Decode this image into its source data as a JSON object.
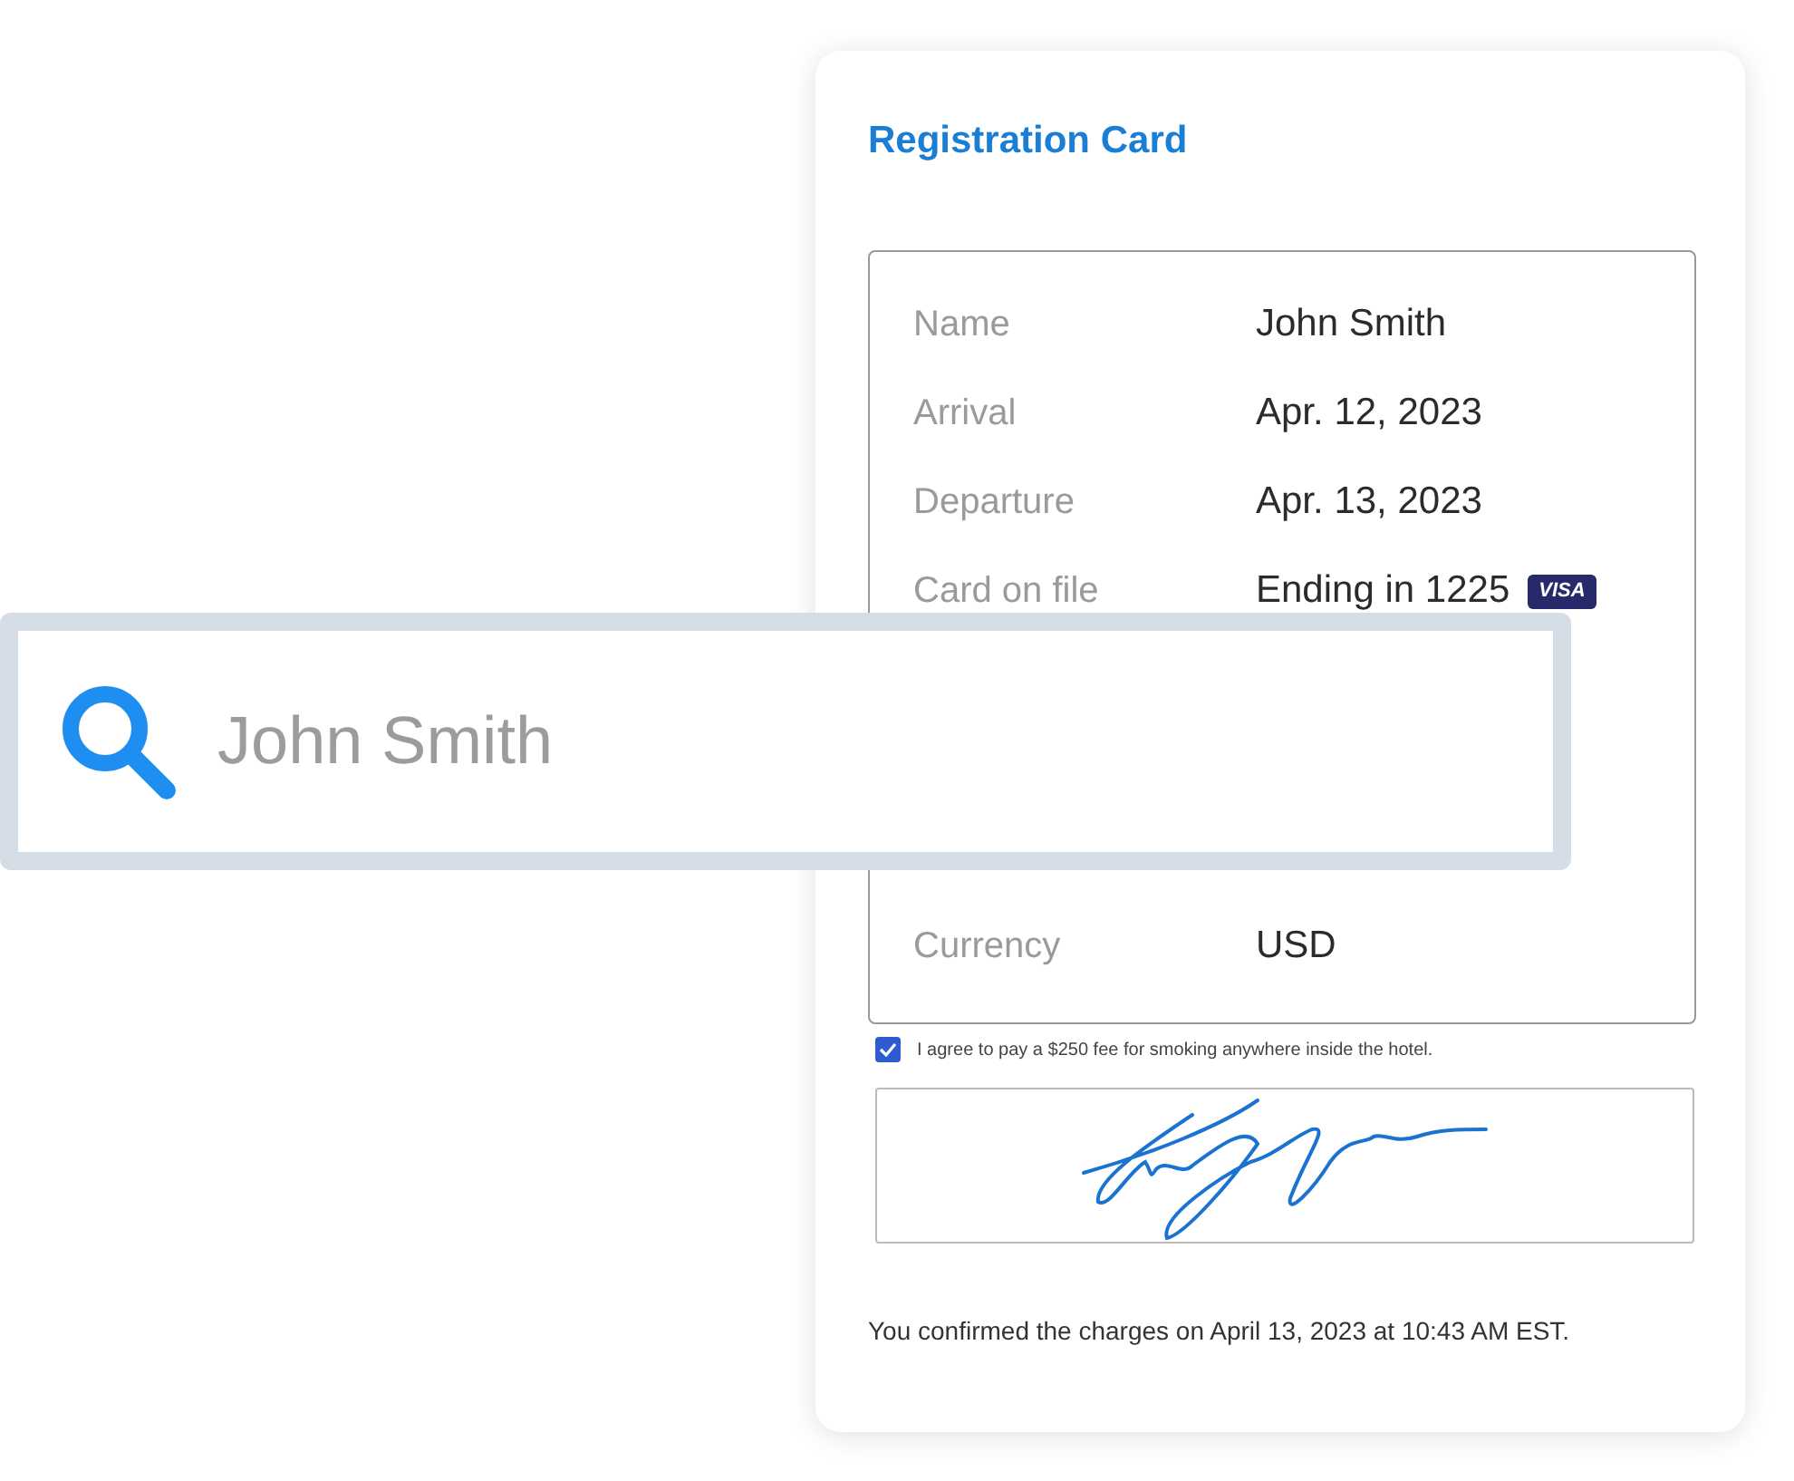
{
  "card": {
    "title": "Registration Card",
    "details": [
      {
        "label": "Name",
        "value": "John Smith"
      },
      {
        "label": "Arrival",
        "value": "Apr. 12, 2023"
      },
      {
        "label": "Departure",
        "value": "Apr. 13, 2023"
      },
      {
        "label": "Card on file",
        "value": "Ending in 1225",
        "badge": "VISA"
      },
      {
        "kind": "hidden"
      },
      {
        "label": "Currency",
        "value": "USD"
      }
    ],
    "agreement": {
      "checked": true,
      "text": "I agree to pay a $250 fee for smoking anywhere inside the hotel."
    },
    "confirmation": "You confirmed the charges on April 13, 2023 at 10:43 AM EST."
  },
  "search": {
    "value": "John Smith"
  }
}
